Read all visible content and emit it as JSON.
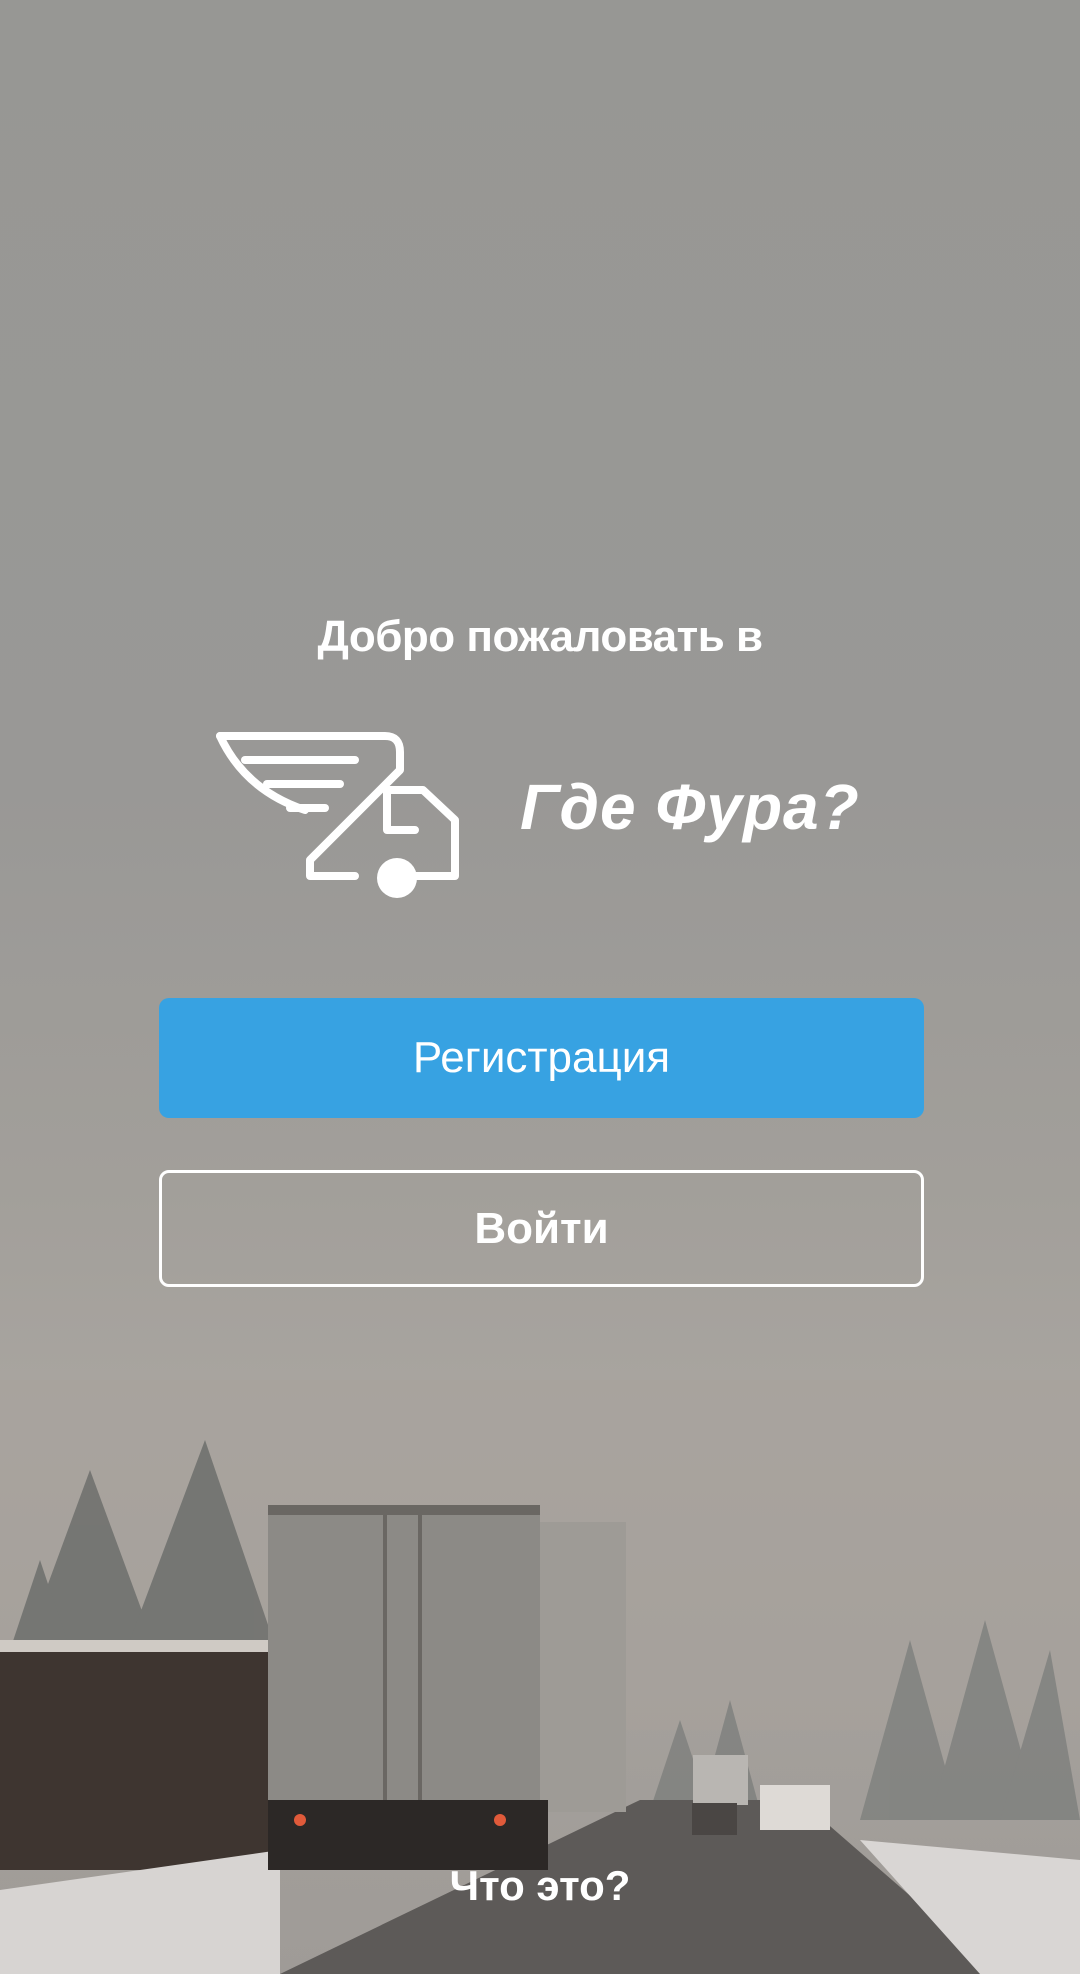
{
  "welcome": {
    "title": "Добро пожаловать в"
  },
  "brand": {
    "name": "Где Фура?",
    "logo_icon": "winged-truck-icon"
  },
  "actions": {
    "register_label": "Регистрация",
    "login_label": "Войти",
    "about_label": "Что это?"
  },
  "colors": {
    "accent": "#37a2e2",
    "text": "#ffffff"
  }
}
